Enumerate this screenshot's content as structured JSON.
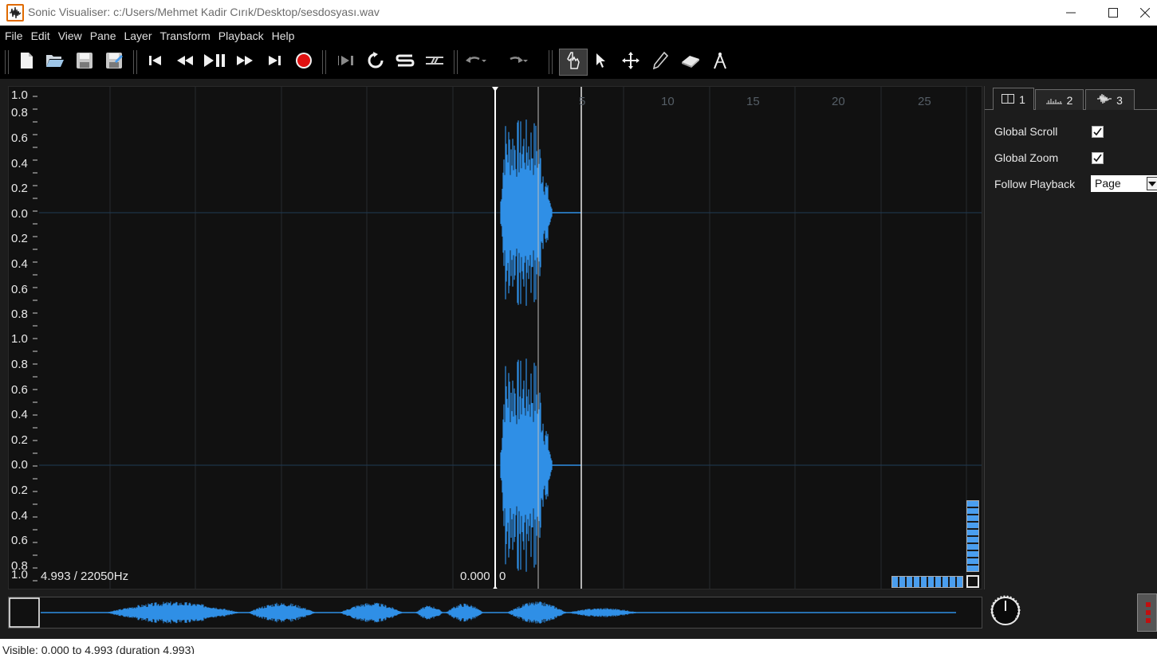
{
  "window": {
    "title": "Sonic Visualiser: c:/Users/Mehmet Kadir Cırık/Desktop/sesdosyası.wav",
    "minimize_glyph": "—",
    "maximize_glyph": "☐",
    "close_glyph": "×"
  },
  "menu": [
    "File",
    "Edit",
    "View",
    "Pane",
    "Layer",
    "Transform",
    "Playback",
    "Help"
  ],
  "toolbar": {
    "file_icons": [
      "new-file-icon",
      "open-file-icon",
      "save-icon",
      "save-as-icon"
    ],
    "transport_icons": [
      "rewind-start-icon",
      "rewind-icon",
      "play-pause-icon",
      "fast-forward-icon",
      "fast-forward-end-icon",
      "record-icon"
    ],
    "playback_mode_icons": [
      "play-selection-icon",
      "loop-icon",
      "solo-icon",
      "align-icon"
    ],
    "edit_icons": [
      "undo-icon",
      "redo-icon"
    ],
    "tool_icons": [
      "navigate-tool-icon",
      "select-tool-icon",
      "move-tool-icon",
      "draw-tool-icon",
      "erase-tool-icon",
      "measure-tool-icon"
    ],
    "active_tool": "navigate-tool-icon"
  },
  "pane": {
    "scale_labels_top": [
      "1.0",
      "0.8",
      "0.6",
      "0.4",
      "0.2",
      "0.0",
      "0.2",
      "0.4",
      "0.6",
      "0.8"
    ],
    "scale_labels_bottom": [
      "1.0",
      "0.8",
      "0.6",
      "0.4",
      "0.2",
      "0.0",
      "0.2",
      "0.4",
      "0.6",
      "0.8",
      "1.0"
    ],
    "ruler_labels": [
      "5",
      "10",
      "15",
      "20",
      "25"
    ],
    "info_left": "4.993 / 22050Hz",
    "info_playhead": "0.000",
    "info_playhead_zero": "0",
    "waveform_color": "#2f8fe6"
  },
  "panel": {
    "tabs": [
      {
        "icon": "pane-tab-icon",
        "label": "1"
      },
      {
        "icon": "spectrum-tab-icon",
        "label": "2"
      },
      {
        "icon": "waveform-tab-icon",
        "label": "3"
      }
    ],
    "global_scroll_label": "Global Scroll",
    "global_scroll_checked": true,
    "global_zoom_label": "Global Zoom",
    "global_zoom_checked": true,
    "follow_playback_label": "Follow Playback",
    "follow_playback_value": "Page"
  },
  "status": {
    "text": "Visible: 0.000 to 4.993 (duration 4.993)"
  }
}
